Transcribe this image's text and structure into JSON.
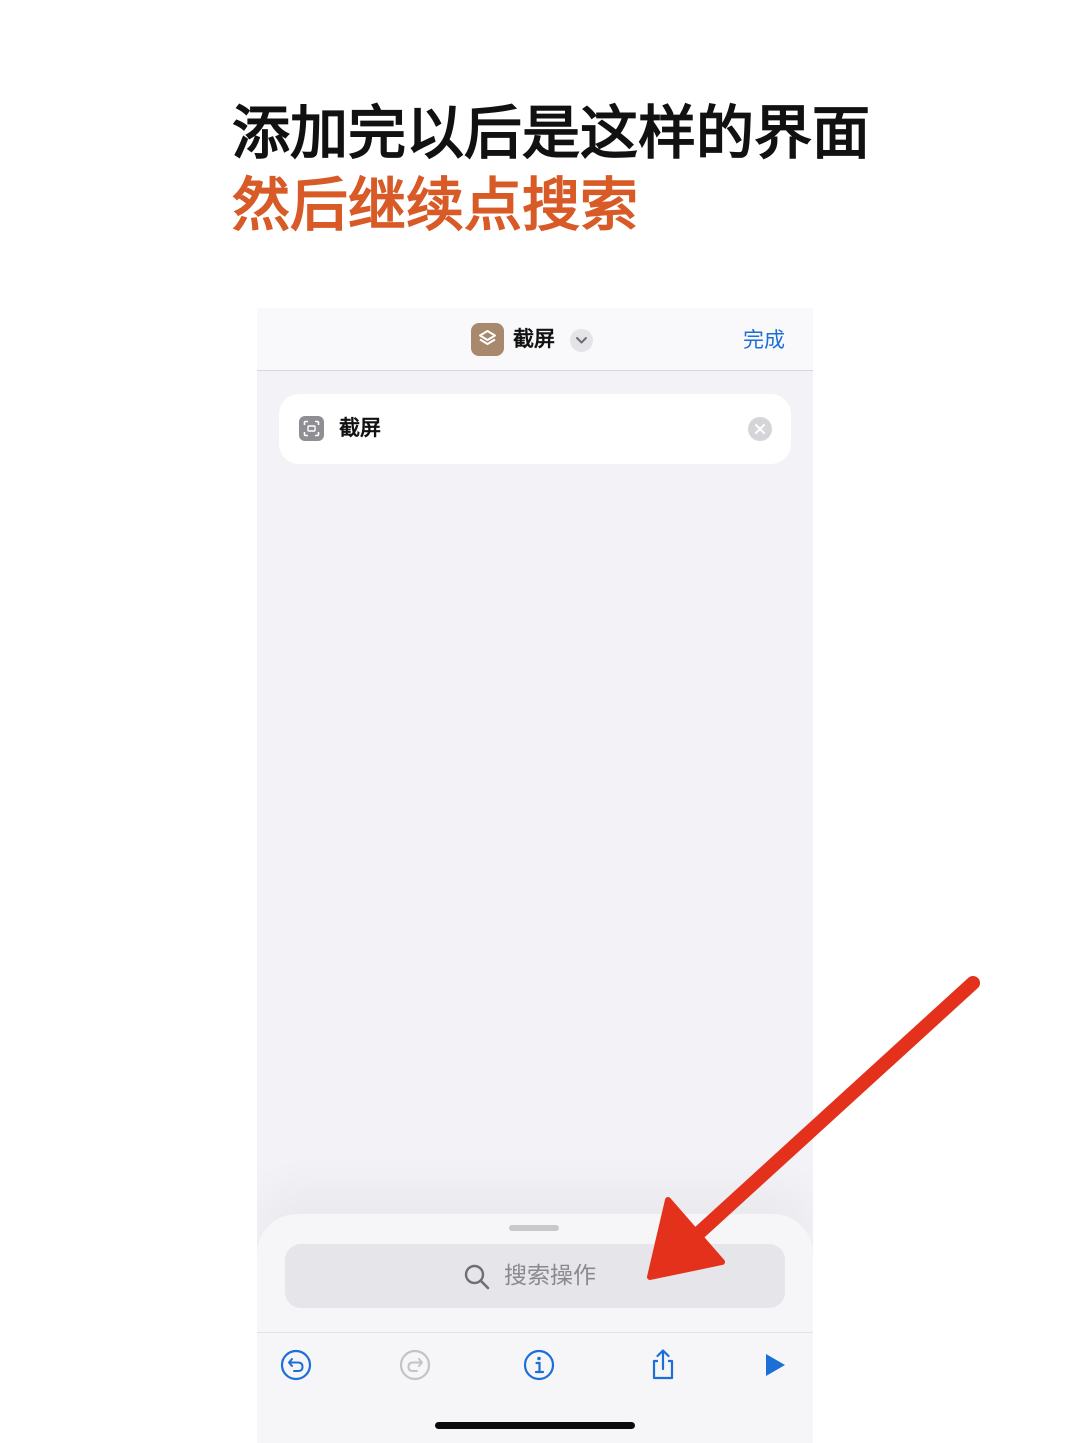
{
  "caption": {
    "line1": "添加完以后是这样的界面",
    "line2": "然后继续点搜索",
    "line2_color": "#d75a27"
  },
  "navbar": {
    "app_icon": "shortcuts-icon",
    "title": "截屏",
    "title_menu_icon": "chevron-down-icon",
    "done_label": "完成"
  },
  "actions": [
    {
      "icon": "screenshot-icon",
      "label": "截屏",
      "remove_icon": "close-icon"
    }
  ],
  "search": {
    "icon": "search-icon",
    "placeholder": "搜索操作"
  },
  "toolbar": {
    "items": [
      {
        "name": "undo",
        "icon": "undo-icon",
        "enabled": true
      },
      {
        "name": "redo",
        "icon": "redo-icon",
        "enabled": false
      },
      {
        "name": "info",
        "icon": "info-icon",
        "enabled": true
      },
      {
        "name": "share",
        "icon": "share-icon",
        "enabled": true
      },
      {
        "name": "run",
        "icon": "play-icon",
        "enabled": true
      }
    ]
  },
  "colors": {
    "accent": "#1c6fd6",
    "annotation_arrow": "#e3311c",
    "app_icon_bg": "#a8896e"
  }
}
